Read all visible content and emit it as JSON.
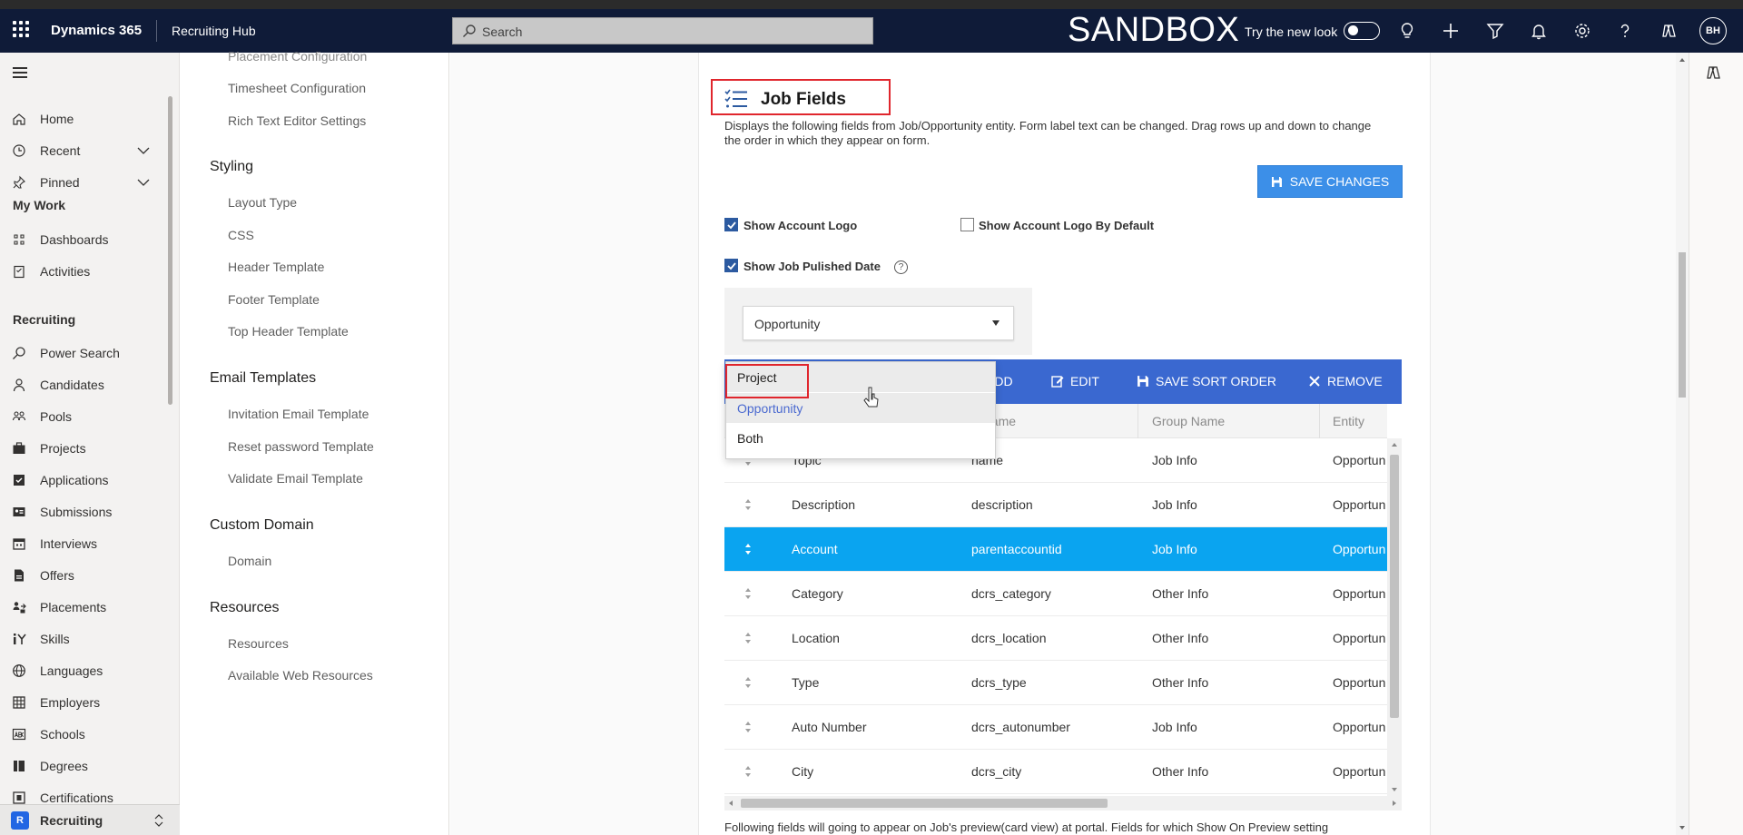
{
  "header": {
    "app_title": "Dynamics 365",
    "hub_title": "Recruiting Hub",
    "search_placeholder": "Search",
    "environment": "SANDBOX",
    "try_new_look": "Try the new look",
    "avatar_initials": "BH"
  },
  "nav": {
    "home": "Home",
    "recent": "Recent",
    "pinned": "Pinned",
    "my_work": "My Work",
    "dashboards": "Dashboards",
    "activities": "Activities",
    "recruiting_section": "Recruiting",
    "power_search": "Power Search",
    "candidates": "Candidates",
    "pools": "Pools",
    "projects": "Projects",
    "applications": "Applications",
    "submissions": "Submissions",
    "interviews": "Interviews",
    "offers": "Offers",
    "placements": "Placements",
    "skills": "Skills",
    "languages": "Languages",
    "employers": "Employers",
    "schools": "Schools",
    "degrees": "Degrees",
    "certifications": "Certifications",
    "area_badge": "R",
    "area_label": "Recruiting"
  },
  "settings": {
    "placement_config": "Placement Configuration",
    "timesheet_config": "Timesheet Configuration",
    "rich_text": "Rich Text Editor Settings",
    "styling": "Styling",
    "layout_type": "Layout Type",
    "css": "CSS",
    "header_template": "Header Template",
    "footer_template": "Footer Template",
    "top_header_template": "Top Header Template",
    "email_templates": "Email Templates",
    "invitation_email": "Invitation Email Template",
    "reset_password": "Reset password Template",
    "validate_email": "Validate Email Template",
    "custom_domain": "Custom Domain",
    "domain": "Domain",
    "resources_section": "Resources",
    "resources": "Resources",
    "web_resources": "Available Web Resources"
  },
  "job_fields": {
    "title": "Job Fields",
    "description": "Displays the following fields from Job/Opportunity entity. Form label text can be changed. Drag rows up and down to change the order in which they appear on form.",
    "save_changes": "SAVE CHANGES",
    "show_account_logo": "Show Account Logo",
    "show_account_logo_default": "Show Account Logo By Default",
    "show_job_published": "Show Job Pulished Date",
    "help": "?",
    "select_value": "Opportunity",
    "toolbar": {
      "add": "ADD",
      "edit": "EDIT",
      "save_sort": "SAVE SORT ORDER",
      "remove": "REMOVE"
    },
    "columns": {
      "field_name": "d Name",
      "group_name": "Group Name",
      "entity": "Entity"
    },
    "rows": [
      {
        "label": "Topic",
        "field": "name",
        "group": "Job Info",
        "entity": "Opportun"
      },
      {
        "label": "Description",
        "field": "description",
        "group": "Job Info",
        "entity": "Opportun"
      },
      {
        "label": "Account",
        "field": "parentaccountid",
        "group": "Job Info",
        "entity": "Opportun"
      },
      {
        "label": "Category",
        "field": "dcrs_category",
        "group": "Other Info",
        "entity": "Opportun"
      },
      {
        "label": "Location",
        "field": "dcrs_location",
        "group": "Other Info",
        "entity": "Opportun"
      },
      {
        "label": "Type",
        "field": "dcrs_type",
        "group": "Other Info",
        "entity": "Opportun"
      },
      {
        "label": "Auto Number",
        "field": "dcrs_autonumber",
        "group": "Job Info",
        "entity": "Opportun"
      },
      {
        "label": "City",
        "field": "dcrs_city",
        "group": "Other Info",
        "entity": "Opportun"
      }
    ],
    "dropdown_options": [
      "Project",
      "Opportunity",
      "Both"
    ],
    "footer_note": "Following fields will going to appear on Job's preview(card view) at portal. Fields for which Show On Preview setting"
  },
  "colors": {
    "header_bg": "#0f1b38",
    "accent_blue": "#3a68d0",
    "selected_row": "#0aa4f0",
    "highlight_red": "#e0262d"
  }
}
